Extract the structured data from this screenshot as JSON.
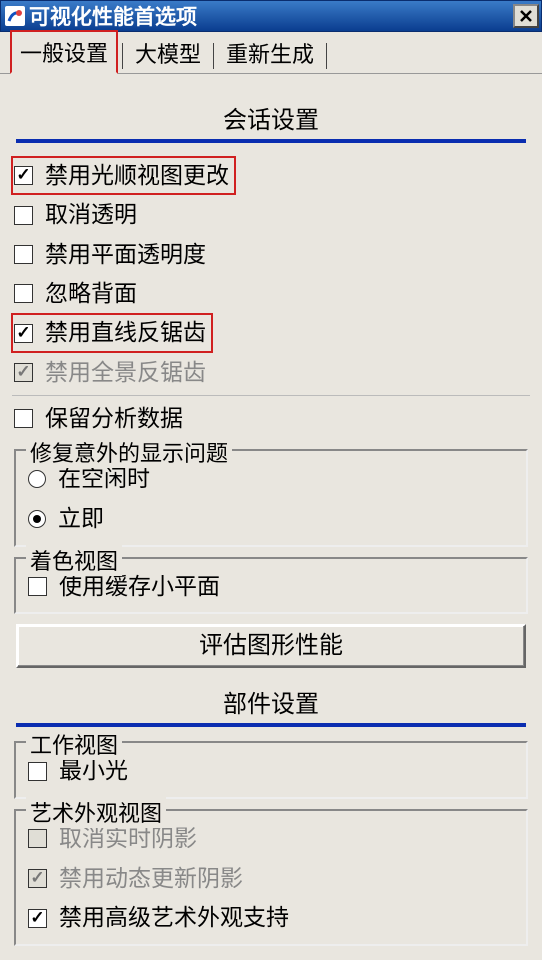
{
  "window": {
    "title": "可视化性能首选项"
  },
  "tabs": {
    "general": "一般设置",
    "large_model": "大模型",
    "regenerate": "重新生成"
  },
  "session": {
    "header": "会话设置",
    "opt_disable_smooth_view": "禁用光顺视图更改",
    "opt_cancel_transparent": "取消透明",
    "opt_disable_plane_transparency": "禁用平面透明度",
    "opt_ignore_backside": "忽略背面",
    "opt_disable_line_aa": "禁用直线反锯齿",
    "opt_disable_pano_aa": "禁用全景反锯齿",
    "opt_keep_analysis": "保留分析数据",
    "group_fix": {
      "legend": "修复意外的显示问题",
      "idle": "在空闲时",
      "now": "立即"
    },
    "group_shade": {
      "legend": "着色视图",
      "use_cache_faces": "使用缓存小平面"
    },
    "btn_evaluate": "评估图形性能"
  },
  "part": {
    "header": "部件设置",
    "group_work": {
      "legend": "工作视图",
      "min_light": "最小光"
    },
    "group_art": {
      "legend": "艺术外观视图",
      "cancel_realtime_shadow": "取消实时阴影",
      "disable_dynamic_shadow": "禁用动态更新阴影",
      "disable_advanced_art": "禁用高级艺术外观支持"
    }
  }
}
